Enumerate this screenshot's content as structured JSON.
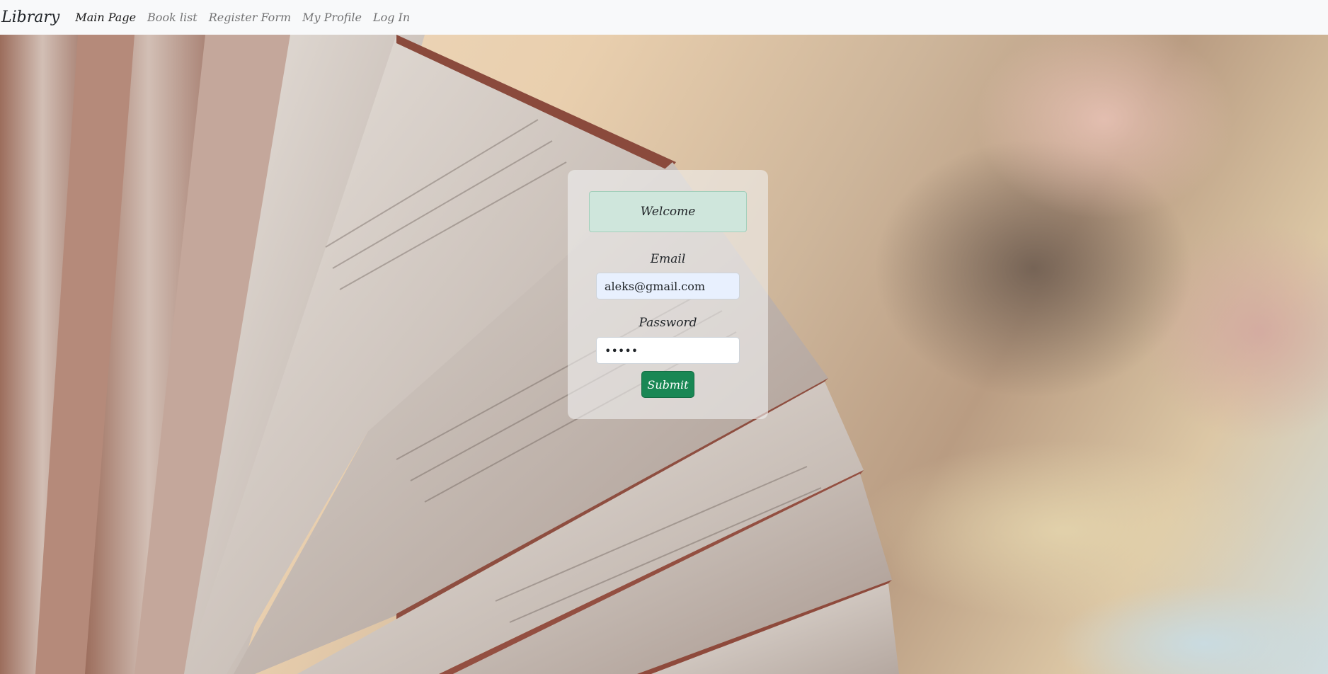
{
  "navbar": {
    "brand": "Library",
    "links": [
      {
        "label": "Main Page",
        "active": true
      },
      {
        "label": "Book list",
        "active": false
      },
      {
        "label": "Register Form",
        "active": false
      },
      {
        "label": "My Profile",
        "active": false
      },
      {
        "label": "Log In",
        "active": false
      }
    ]
  },
  "background": {
    "subject": "open book pages, blurred background"
  },
  "login": {
    "welcome": "Welcome",
    "email_label": "Email",
    "email_value": "aleks@gmail.com",
    "password_label": "Password",
    "password_value": "•••••",
    "submit_label": "Submit"
  },
  "colors": {
    "navbar_bg": "#f8f9fa",
    "welcome_bg": "#cfe6dc",
    "submit_bg": "#198754",
    "email_bg": "#e8f0fe"
  }
}
